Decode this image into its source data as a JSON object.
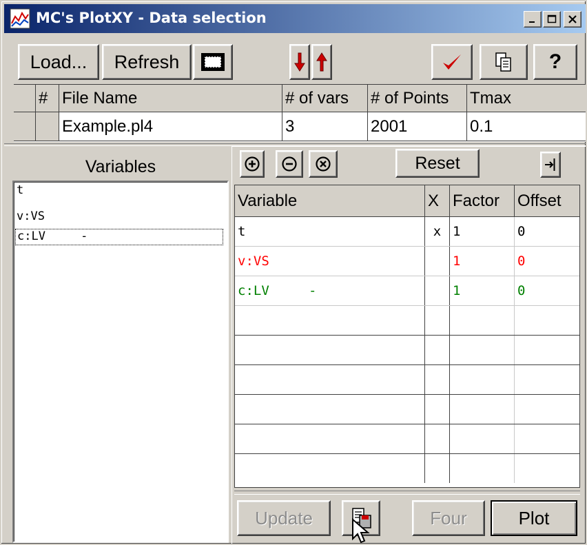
{
  "window": {
    "title": "MC's PlotXY - Data selection"
  },
  "toolbar": {
    "load_label": "Load...",
    "refresh_label": "Refresh",
    "help_label": "?"
  },
  "file_table": {
    "columns": [
      "#",
      "File Name",
      "# of vars",
      "# of Points",
      "Tmax"
    ],
    "rows": [
      {
        "index": "",
        "file_name": "Example.pl4",
        "vars": "3",
        "points": "2001",
        "tmax": "0.1"
      }
    ]
  },
  "variables_panel": {
    "label": "Variables",
    "items": [
      "t",
      "v:VS",
      "c:LV     -"
    ]
  },
  "selection_panel": {
    "reset_label": "Reset",
    "columns": [
      "Variable",
      "X",
      "Factor",
      "Offset"
    ],
    "rows": [
      {
        "variable": "t",
        "x": "x",
        "factor": "1",
        "offset": "0",
        "color": "#000000"
      },
      {
        "variable": "v:VS",
        "x": "",
        "factor": "1",
        "offset": "0",
        "color": "#ff0000"
      },
      {
        "variable": "c:LV     -",
        "x": "",
        "factor": "1",
        "offset": "0",
        "color": "#008000"
      }
    ],
    "empty_rows": 6
  },
  "bottom_bar": {
    "update_label": "Update",
    "four_label": "Four",
    "plot_label": "Plot"
  },
  "colors": {
    "titlebar_start": "#0a246a",
    "titlebar_end": "#a6caf0",
    "face": "#d4d0c8",
    "check": "#cc0000",
    "arrow": "#cc0000"
  }
}
